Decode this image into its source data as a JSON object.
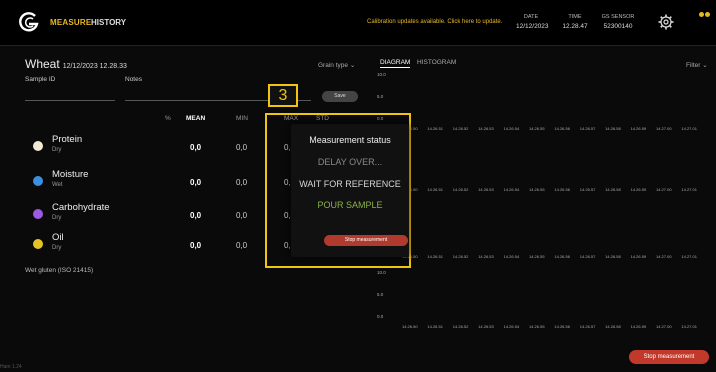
{
  "header": {
    "nav": {
      "measure": "MEASURE",
      "history": "HISTORY"
    },
    "notice": "Calibration updates available. Click here to update.",
    "date_label": "DATE",
    "date_value": "12/12/2023",
    "time_label": "TIME",
    "time_value": "12.28.47",
    "sensor_label": "GS SENSOR",
    "sensor_value": "52300140",
    "accent": "#e6b923"
  },
  "sample": {
    "name": "Wheat",
    "timestamp": "12/12/2023 12.28.33",
    "sample_id_label": "Sample ID",
    "notes_label": "Notes",
    "save_label": "Save",
    "grain_type": "Grain type"
  },
  "table": {
    "col_pct": "%",
    "col_mean": "MEAN",
    "col_min": "MIN",
    "col_max": "MAX",
    "col_std": "STD",
    "rows": [
      {
        "name": "Protein",
        "sub": "Dry",
        "mean": "0,0",
        "min": "0,0",
        "max": "0,",
        "color": "#f0ead2"
      },
      {
        "name": "Moisture",
        "sub": "Wet",
        "mean": "0,0",
        "min": "0,0",
        "max": "0,",
        "color": "#3b8fe0"
      },
      {
        "name": "Carbohydrate",
        "sub": "Dry",
        "mean": "0,0",
        "min": "0,0",
        "max": "0,",
        "color": "#9b59e6"
      },
      {
        "name": "Oil",
        "sub": "Dry",
        "mean": "0,0",
        "min": "0,0",
        "max": "0,",
        "color": "#e6c229"
      }
    ],
    "wet_gluten": "Wet gluten (ISO 21415)"
  },
  "charts": {
    "tab_diagram": "DIAGRAM",
    "tab_histogram": "HISTOGRAM",
    "filter": "Filter",
    "y_ticks": [
      "10.0",
      "5.0",
      "0.0"
    ],
    "x_ticks": [
      "14.26.50",
      "14.26.51",
      "14.26.52",
      "14.26.53",
      "14.26.54",
      "14.26.55",
      "14.26.56",
      "14.26.57",
      "14.26.58",
      "14.26.59",
      "14.27.00",
      "14.27.01"
    ]
  },
  "modal": {
    "title": "Measurement status",
    "line1": "DELAY OVER...",
    "line2": "WAIT FOR REFERENCE",
    "line3": "POUR SAMPLE",
    "stop_label": "Stop measurement"
  },
  "annotation": {
    "step": "3"
  },
  "footer": {
    "stop_label": "Stop measurement",
    "cut_text": "Ham 1.24"
  }
}
